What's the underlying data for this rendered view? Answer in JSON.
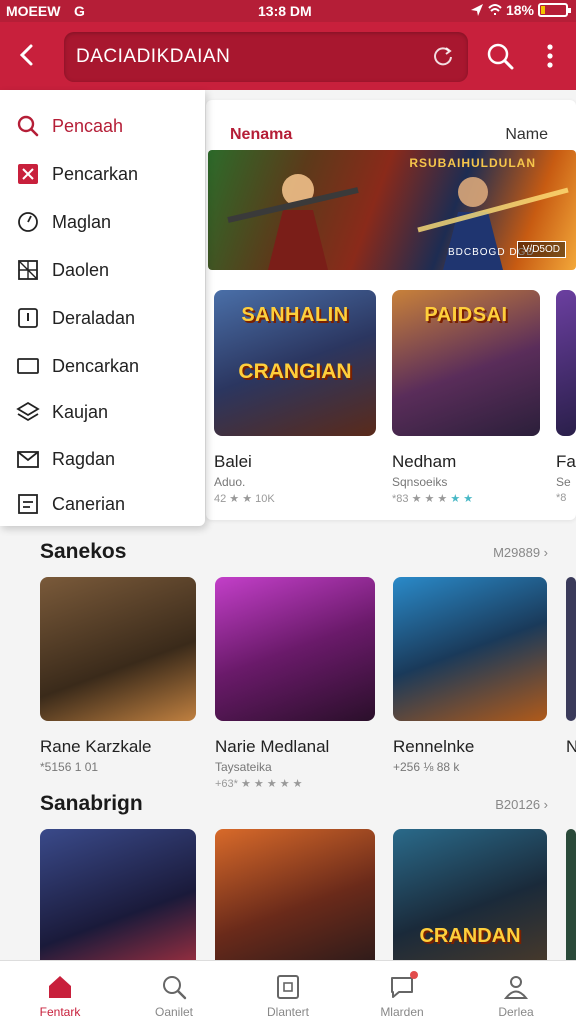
{
  "status": {
    "left": "MOEEW",
    "signal": "G",
    "time": "13:8 DM",
    "battery": "18%",
    "battery_level": 0.18
  },
  "appbar": {
    "search_value": "DACIADIKDAIAN"
  },
  "menu": {
    "items": [
      {
        "label": "Pencaah",
        "icon": "search-icon"
      },
      {
        "label": "Pencarkan",
        "icon": "close-box-icon"
      },
      {
        "label": "Maglan",
        "icon": "clock-icon"
      },
      {
        "label": "Daolen",
        "icon": "grid-icon"
      },
      {
        "label": "Deraladan",
        "icon": "info-icon"
      },
      {
        "label": "Dencarkan",
        "icon": "square-icon"
      },
      {
        "label": "Kaujan",
        "icon": "layers-icon"
      },
      {
        "label": "Ragdan",
        "icon": "mail-icon"
      },
      {
        "label": "Canerian",
        "icon": "list-icon"
      }
    ]
  },
  "featured": {
    "header_left": "Nenama",
    "header_right": "Name",
    "banner_title": "RSUBAIHULDULAN",
    "banner_foot": "BDCBOGD DGD",
    "banner_badge": "V/D5OD",
    "tiles": [
      {
        "art_line1": "SANHALIN",
        "art_line2": "CRANGIAN",
        "name": "Balei",
        "sub": "Aduo.",
        "meta": "42 ★ ★ 10K"
      },
      {
        "art_line1": "PAIDSAI",
        "art_line2": "",
        "name": "Nedham",
        "sub": "Sqnsoeiks",
        "meta": "*83 ★ ★ ★"
      },
      {
        "art_line1": "",
        "art_line2": "",
        "name": "Fa",
        "sub": "Se",
        "meta": "*8"
      }
    ]
  },
  "sections": [
    {
      "title": "Sanekos",
      "more": "M29889 ›",
      "tiles": [
        {
          "name": "Rane Karzkale",
          "sub": "*5156 1 01",
          "meta": ""
        },
        {
          "name": "Narie Medlanal",
          "sub": "Taysateika",
          "meta": "+63* ★ ★ ★ ★ ★"
        },
        {
          "name": "Rennelnke",
          "sub": "+256 ⅛ 88 k",
          "meta": ""
        },
        {
          "name": "N",
          "sub": "",
          "meta": ""
        }
      ]
    },
    {
      "title": "Sanabrign",
      "more": "B20126 ›",
      "tiles": [
        {
          "art_line1": "",
          "name": "",
          "sub": "",
          "meta": ""
        },
        {
          "art_line1": "",
          "name": "",
          "sub": "",
          "meta": ""
        },
        {
          "art_line1": "CRANDAN",
          "name": "",
          "sub": "",
          "meta": ""
        },
        {
          "art_line1": "",
          "name": "",
          "sub": "",
          "meta": ""
        }
      ]
    }
  ],
  "bottom_nav": [
    {
      "label": "Fentark",
      "icon": "home-icon"
    },
    {
      "label": "Oanilet",
      "icon": "search-icon"
    },
    {
      "label": "Dlantert",
      "icon": "square-icon"
    },
    {
      "label": "Mlarden",
      "icon": "chat-icon"
    },
    {
      "label": "Derlea",
      "icon": "person-icon"
    }
  ],
  "colors": {
    "accent": "#c8203c",
    "status_bar": "#b51e37",
    "star_highlight": "#48b8c6"
  }
}
